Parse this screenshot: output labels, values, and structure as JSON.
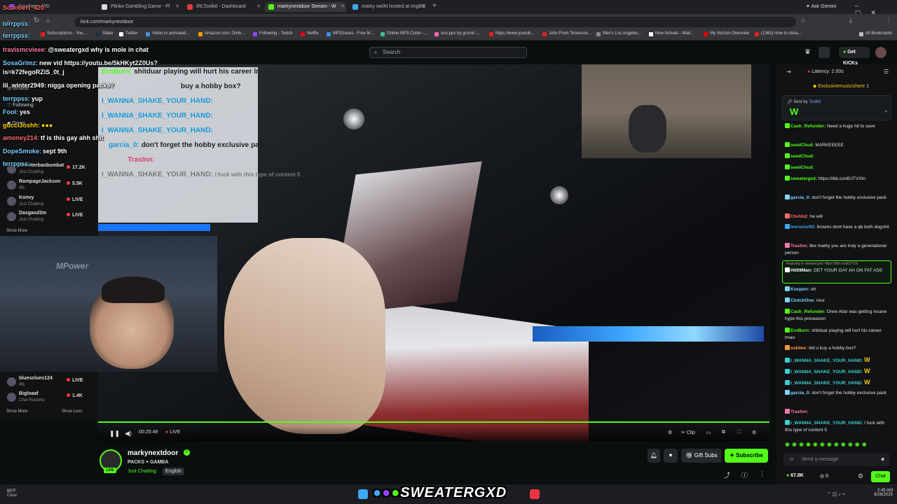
{
  "browser": {
    "tabs": [
      {
        "label": "Scoobert_420:",
        "color": "#9146ff"
      },
      {
        "label": "Plinko Gambling Game - Pl",
        "color": "#dddddd"
      },
      {
        "label": "IRLToolkit - Dashboard",
        "color": "#e03d3d"
      },
      {
        "label": "markynextdoor Stream - W",
        "color": "#53fc18"
      },
      {
        "label": "marky welht hosted at ImgBB",
        "color": "#3fa9f5"
      }
    ],
    "ask_gemini": "Ask Gemini",
    "url": "kick.com/markynextdoor",
    "bookmarks": [
      {
        "label": "Subscriptions - You...",
        "color": "#e62117"
      },
      {
        "label": "Stake",
        "color": "#1e2e3b"
      },
      {
        "label": "Twitter",
        "color": "#ffffff"
      },
      {
        "label": "Video to animated...",
        "color": "#4a90d9"
      },
      {
        "label": "Amazon.com: Onlin...",
        "color": "#ff9900"
      },
      {
        "label": "Following - Twitch",
        "color": "#9146ff"
      },
      {
        "label": "Netflix",
        "color": "#e50914"
      },
      {
        "label": "MP3Juices - Free M...",
        "color": "#3b8ede"
      },
      {
        "label": "Online MP3 Cutter -...",
        "color": "#3fbf8f"
      },
      {
        "label": "osu-pps by grumd -...",
        "color": "#ff66aa"
      },
      {
        "label": "https://www.youtub...",
        "color": "#e62117"
      },
      {
        "label": "John From Tennesse...",
        "color": "#e62117"
      },
      {
        "label": "Men's Los Angeles...",
        "color": "#888888"
      },
      {
        "label": "New Arrivals - Mad...",
        "color": "#ffffff"
      },
      {
        "label": "My Verizon Overview",
        "color": "#e30000"
      },
      {
        "label": "(1363) How to strea...",
        "color": "#e62117"
      }
    ],
    "all_bookmarks": "All Bookmarks"
  },
  "kick": {
    "search_placeholder": "Search",
    "get_kicks": "Get KICKs"
  },
  "overlay_chat": [
    {
      "user": "Scoobert_420:",
      "text": "",
      "color": "#ff6b6b"
    },
    {
      "user": "terrppss:",
      "text": "",
      "color": "#7fd3ff"
    },
    {
      "user": "travismcvieee:",
      "text": "@sweatergxd why is mole in chat",
      "color": "#ff7aa8"
    },
    {
      "user": "SosaGrimz:",
      "text": "new vid https://youtu.be/5kHKyt2Z0Us?",
      "color": "#7fd3ff"
    },
    {
      "user": "",
      "text": "is=k72fegoRZiS_0t_j",
      "color": "#ffffff"
    },
    {
      "user": "lil_winter2949:",
      "text": "nigga opening packs?",
      "color": "#ffffff"
    },
    {
      "user": "terrppss:",
      "text": "yup",
      "color": "#7fd3ff"
    },
    {
      "user": "Fool:",
      "text": "yes",
      "color": "#7fd3ff"
    },
    {
      "user": "gucciJoshh:",
      "text": "",
      "color": "#ffd400"
    },
    {
      "user": "amoney214:",
      "text": "tf is this gay ahh shit",
      "color": "#ff6b6b"
    },
    {
      "user": "DopeSmoke:",
      "text": "sept 9th",
      "color": "#7fd3ff"
    },
    {
      "user": "terrppss:",
      "text": "",
      "color": "#7fd3ff"
    }
  ],
  "stream_overlay": [
    {
      "user": "ErnBurn:",
      "text": "shitduar playing will hurt his career lmao"
    },
    {
      "user": "",
      "text": "buy a hobby box?"
    },
    {
      "user": "I_WANNA_SHAKE_YOUR_HAND:",
      "text": ""
    },
    {
      "user": "I_WANNA_SHAKE_YOUR_HAND:",
      "text": ""
    },
    {
      "user": "I_WANNA_SHAKE_YOUR_HAND:",
      "text": ""
    },
    {
      "user": "garcia_0:",
      "text": "don't forget the hobby exclusive pack"
    },
    {
      "user": "TrasInn:",
      "text": ""
    },
    {
      "user": "I_WANNA_SHAKE_YOUR_HAND:",
      "text": "I fuck with this type of content 5"
    }
  ],
  "sidebar": {
    "following_label": "Following",
    "browse_label": "Browse",
    "drops_label": "Drops",
    "channels": [
      {
        "name": "Shooterbanbumbat",
        "category": "Just Chatting",
        "viewers": "17.2K",
        "live": false
      },
      {
        "name": "RampageJackson",
        "category": "IRL",
        "viewers": "5.5K",
        "live": false
      },
      {
        "name": "Konvy",
        "category": "Just Chatting",
        "viewers": "LIVE",
        "live": true
      },
      {
        "name": "Dasgasd3m",
        "category": "Just Chatting",
        "viewers": "LIVE",
        "live": true
      }
    ],
    "show_more": "Show More",
    "channels_bottom": [
      {
        "name": "bluesclues124",
        "category": "IRL",
        "viewers": "LIVE",
        "live": true
      },
      {
        "name": "Bigloaaf",
        "category": "Chat Roulette",
        "viewers": "1.4K",
        "live": false
      }
    ],
    "show_more_2": "Show More",
    "show_less": "Show Less"
  },
  "webcam": {
    "brand": "MPower"
  },
  "player": {
    "time": "00:25:49",
    "live": "LIVE",
    "clip": "Clip",
    "progress_percent": 100
  },
  "stream": {
    "name": "markynextdoor",
    "title": "PACKS + GAMBA",
    "category": "Just Chatting",
    "language": "English",
    "live_badge": "LIVE",
    "gift_subs": "Gift Subs",
    "subscribe": "Subscribe"
  },
  "chat": {
    "latency": "Latency: 2.00s",
    "exclusive": "Exclusivemusicishere",
    "exclusive_count": "1",
    "pinned_by": "Sent by",
    "pinned_user": "Toolkit",
    "pinned_text": "W",
    "messages": [
      {
        "user": "Cash_Refunder:",
        "text": "Need a huge hit to save",
        "color": "#53fc18"
      },
      {
        "user": "seedChud:",
        "text": "MARKEEEEE",
        "color": "#53fc18"
      },
      {
        "user": "seedChud:",
        "text": "",
        "color": "#53fc18"
      },
      {
        "user": "seedChud:",
        "text": "",
        "color": "#53fc18"
      },
      {
        "user": "sweatergxd:",
        "text": "https://ibb.co/d0JTVXtn",
        "color": "#53fc18"
      },
      {
        "user": "garcia_0:",
        "text": "don't forget the hobby exclusive pack",
        "color": "#7fd3ff"
      },
      {
        "user": "Chvbb2:",
        "text": "he will",
        "color": "#ff6b6b"
      },
      {
        "user": "iversonz93:",
        "text": "browns dont have a qb both dogshit",
        "color": "#3fa9f5"
      },
      {
        "user": "TrasInn:",
        "text": "like marky you are truly a generational person",
        "color": "#ff7aa8"
      },
      {
        "user": "Hit59Man:",
        "text": "GET YOUR GAY AH ON FAT ASS",
        "color": "#ffffff"
      },
      {
        "user": "Kooperr:",
        "text": "eh",
        "color": "#7fd3ff"
      },
      {
        "user": "ClutchOne:",
        "text": "nice",
        "color": "#7fd3ff"
      },
      {
        "user": "Cash_Refunder:",
        "text": "Drew Allar was getting insane hype this preseason",
        "color": "#53fc18"
      },
      {
        "user": "ErnBurn:",
        "text": "shitduar playing will hurt his career lmao",
        "color": "#53fc18"
      },
      {
        "user": "oskilee:",
        "text": "did u buy a hobby box?",
        "color": "#ff9b3d"
      },
      {
        "user": "I_WANNA_SHAKE_YOUR_HAND:",
        "text": "W",
        "color": "#3fd0d0"
      },
      {
        "user": "I_WANNA_SHAKE_YOUR_HAND:",
        "text": "W",
        "color": "#3fd0d0"
      },
      {
        "user": "I_WANNA_SHAKE_YOUR_HAND:",
        "text": "W",
        "color": "#3fd0d0"
      },
      {
        "user": "garcia_0:",
        "text": "don't forget the hobby exclusive pack",
        "color": "#7fd3ff"
      },
      {
        "user": "TrasInn:",
        "text": "",
        "color": "#ff7aa8"
      },
      {
        "user": "I_WANNA_SHAKE_YOUR_HAND:",
        "text": "I fuck with this type of content 5",
        "color": "#3fd0d0"
      }
    ],
    "reply_label": "Replying to sweatergxd: https://ibb.co/d0JTVX",
    "input_placeholder": "Send a message",
    "kicks_count": "67.8K",
    "zero": "0",
    "chat_button": "Chat"
  },
  "taskbar": {
    "weather_temp": "83°F",
    "weather_desc": "Clear",
    "banner": "SWEATERGXD",
    "time": "2:45 AM",
    "date": "8/28/2025"
  }
}
